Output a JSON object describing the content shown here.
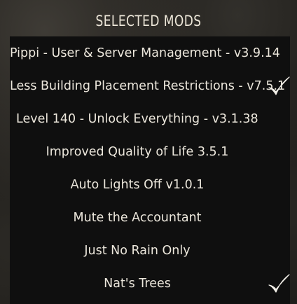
{
  "header": {
    "title": "SELECTED MODS"
  },
  "mods": [
    {
      "label": "Pippi - User & Server Management - v3.9.14",
      "checked": false
    },
    {
      "label": "Less Building Placement Restrictions - v7.5.1",
      "checked": true
    },
    {
      "label": "Level 140 - Unlock Everything - v3.1.38",
      "checked": false
    },
    {
      "label": "Improved Quality of Life 3.5.1",
      "checked": false
    },
    {
      "label": "Auto Lights Off v1.0.1",
      "checked": false
    },
    {
      "label": "Mute the Accountant",
      "checked": false
    },
    {
      "label": "Just No Rain Only",
      "checked": false
    },
    {
      "label": "Nat's Trees",
      "checked": true
    }
  ],
  "colors": {
    "text": "#ece7dc",
    "panel": "#0f0f0f",
    "background": "#1d1b18"
  },
  "icons": {
    "checked_icon": "checkmark-icon"
  }
}
